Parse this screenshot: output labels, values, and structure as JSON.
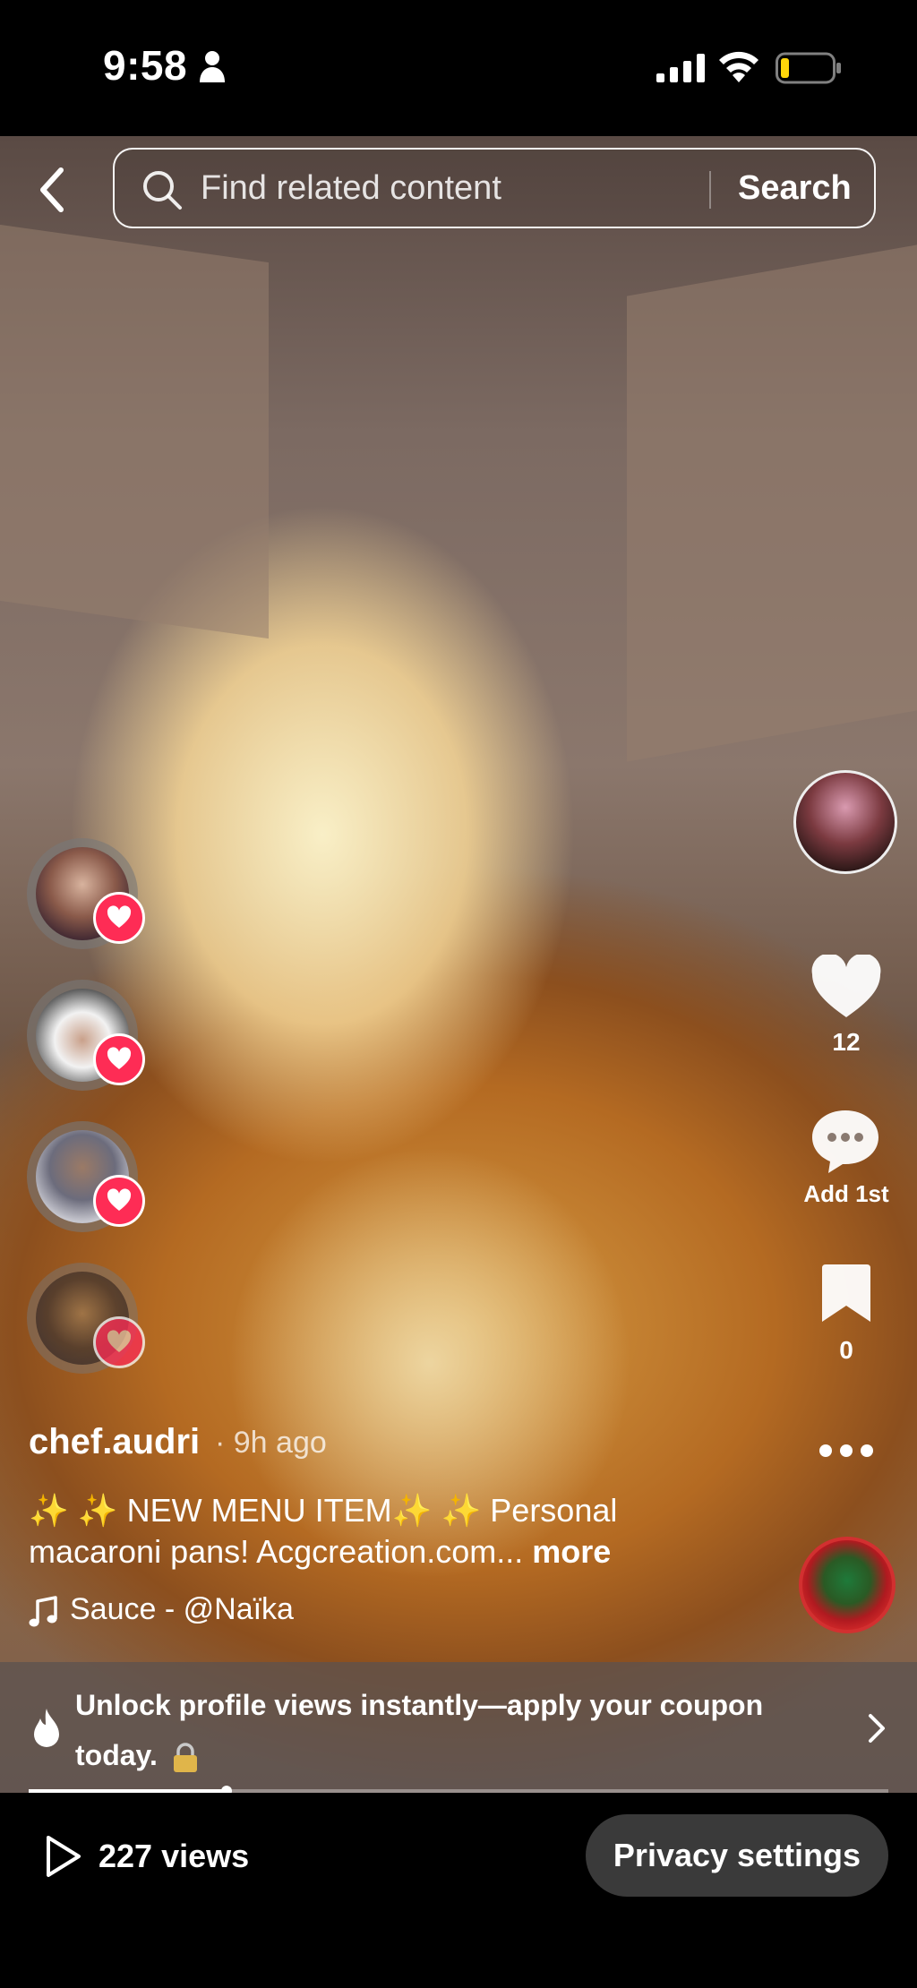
{
  "status_bar": {
    "time": "9:58",
    "icons": [
      "person-icon",
      "signal-icon",
      "wifi-icon",
      "battery-icon"
    ],
    "battery_color": "#ffd60a"
  },
  "search": {
    "placeholder": "Find related content",
    "button_label": "Search"
  },
  "left_avatars": [
    {
      "name": "avatar-1",
      "reacted": true
    },
    {
      "name": "avatar-2",
      "reacted": true
    },
    {
      "name": "avatar-3",
      "reacted": true
    },
    {
      "name": "avatar-4",
      "reacted": true
    }
  ],
  "actions": {
    "likes": "12",
    "comments": "Add 1st",
    "bookmarks": "0"
  },
  "post": {
    "username": "chef.audri",
    "time": "· 9h ago",
    "caption": "✨ ✨ NEW MENU ITEM✨ ✨    Personal macaroni pans! Acgcreation.com...",
    "more": "more",
    "sound": "Sauce - @Naïka"
  },
  "promo": {
    "text": "Unlock profile views instantly—apply your coupon today."
  },
  "progress": {
    "fraction": 0.23
  },
  "bottom": {
    "views": "227 views",
    "privacy_button": "Privacy settings"
  },
  "colors": {
    "accent_red": "#fe2c55",
    "background": "#000000"
  }
}
